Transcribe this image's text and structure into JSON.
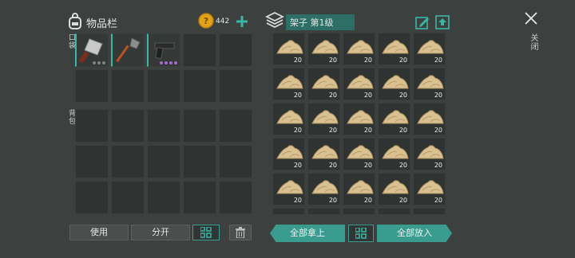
{
  "inventory": {
    "title": "物品栏",
    "coin_count": "442",
    "quickbar_label": "口袋",
    "backpack_label": "背包",
    "use_label": "使用",
    "split_label": "分开"
  },
  "storage": {
    "title": "架子 第1级",
    "take_all_label": "全部拿上",
    "put_all_label": "全部放入",
    "close_label": "关闭",
    "item_count": "20"
  },
  "colors": {
    "accent": "#3a9c8e",
    "coin": "#e3a21a"
  },
  "icons": [
    "backpack-icon",
    "coin-icon",
    "plus-icon",
    "chest-icon",
    "edit-icon",
    "upload-icon",
    "close-icon",
    "grid-icon",
    "trash-icon",
    "cleaver-icon",
    "shovel-icon",
    "pistol-icon",
    "sand-icon"
  ]
}
